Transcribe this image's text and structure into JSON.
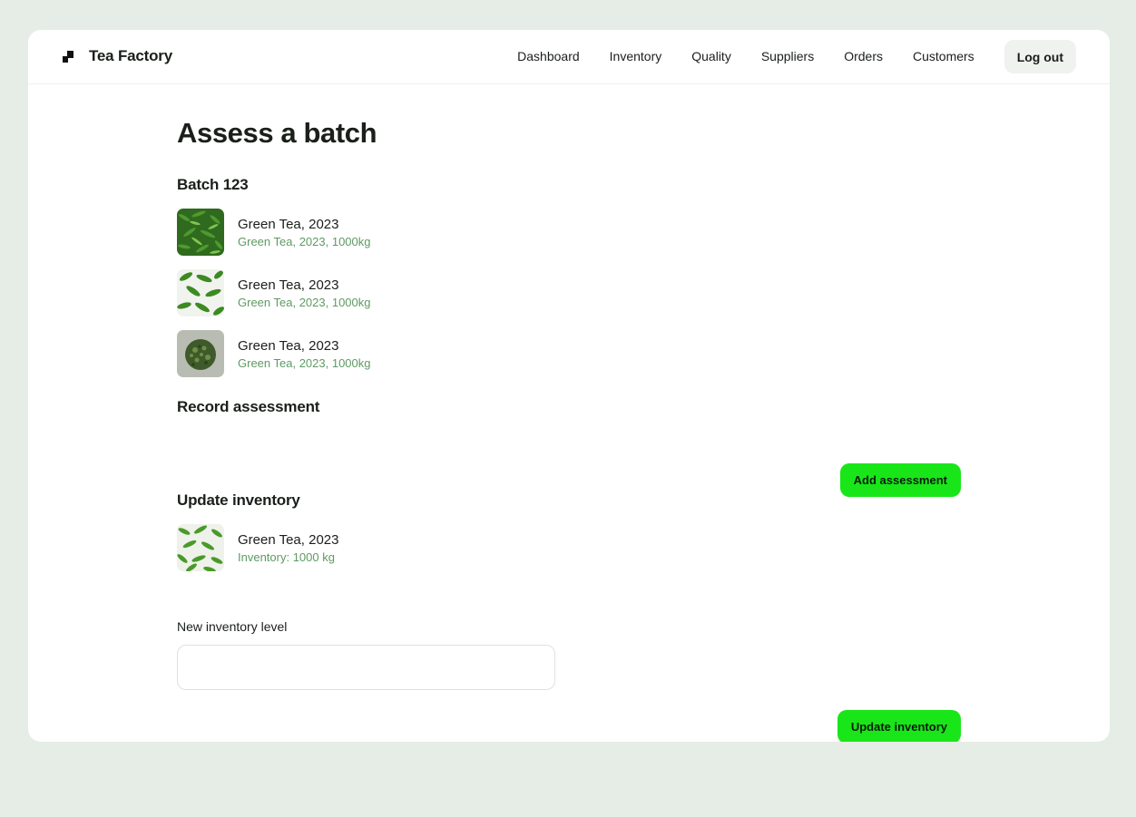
{
  "app": {
    "name": "Tea Factory",
    "logo_icon": "logo-mark-icon"
  },
  "nav": {
    "items": [
      {
        "label": "Dashboard"
      },
      {
        "label": "Inventory"
      },
      {
        "label": "Quality"
      },
      {
        "label": "Suppliers"
      },
      {
        "label": "Orders"
      },
      {
        "label": "Customers"
      }
    ],
    "logout_label": "Log out"
  },
  "page": {
    "title": "Assess a batch"
  },
  "batch": {
    "title": "Batch 123",
    "items": [
      {
        "name": "Green Tea, 2023",
        "details": "Green Tea, 2023, 1000kg",
        "thumbnail": "tea-leaves-closeup"
      },
      {
        "name": "Green Tea, 2023",
        "details": "Green Tea, 2023, 1000kg",
        "thumbnail": "tea-leaves-scattered"
      },
      {
        "name": "Green Tea, 2023",
        "details": "Green Tea, 2023, 1000kg",
        "thumbnail": "tea-leaves-pile"
      }
    ]
  },
  "assessment": {
    "title": "Record assessment",
    "add_button": "Add assessment"
  },
  "inventory": {
    "title": "Update inventory",
    "item": {
      "name": "Green Tea, 2023",
      "details": "Inventory: 1000 kg",
      "thumbnail": "tea-leaves-scattered"
    },
    "field_label": "New inventory level",
    "field_value": "",
    "field_placeholder": "",
    "update_button": "Update inventory"
  },
  "colors": {
    "accent": "#19e619",
    "subtext": "#5e9a63",
    "background": "#e6ede6"
  }
}
